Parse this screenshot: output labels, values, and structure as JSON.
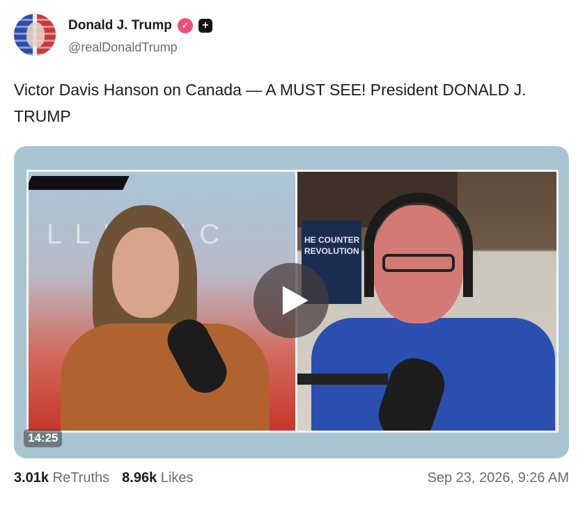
{
  "author": {
    "name": "Donald J. Trump",
    "handle": "@realDonaldTrump",
    "avatar_icon": "flag-portrait-avatar",
    "verified_icon": "verified-badge-icon",
    "plus_icon": "plus-badge-icon"
  },
  "post": {
    "text": "Victor Davis Hanson on Canada — A MUST SEE! President DONALD J. TRUMP"
  },
  "video": {
    "duration": "14:25",
    "play_icon": "play-icon",
    "left_backdrop_text": "LLI MIC",
    "book_title_text": "HE COUNTER REVOLUTION"
  },
  "footer": {
    "retruths_count": "3.01k",
    "retruths_label": "ReTruths",
    "likes_count": "8.96k",
    "likes_label": "Likes",
    "timestamp": "Sep 23, 2026, 9:26 AM"
  },
  "colors": {
    "verified": "#e8527a",
    "video_frame": "#a9c4d1"
  }
}
